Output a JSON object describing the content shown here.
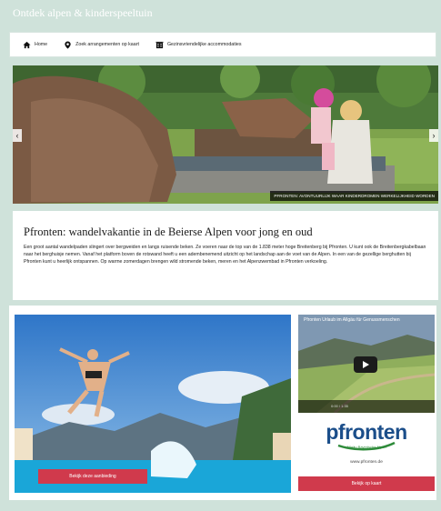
{
  "header": {
    "title": "Ontdek alpen & kinderspeeltuin"
  },
  "nav": {
    "items": [
      {
        "label": "Home",
        "icon": "home-icon"
      },
      {
        "label": "Zoek arrangementen op kaart",
        "icon": "pin-icon"
      },
      {
        "label": "Gezinsvriendelijke accommodaties",
        "icon": "building-icon"
      }
    ]
  },
  "hero": {
    "caption": "PFRONTEN: AVONTUURLIJK WAAR KINDERDROMEN WERKELIJKHEID WORDEN",
    "prev_label": "‹",
    "next_label": "›"
  },
  "article": {
    "title": "Pfronten: wandelvakantie in de Beierse Alpen voor jong en oud",
    "body": "Een groot aantal wandelpaden slingert over bergweiden en langs ruisende beken. Ze voeren naar de top van de 1.838 meter hoge Breitenberg bij Pfronten. U kunt ook de Breitenbergkabelbaan naar het berghuisje nemen. Vanaf het platform boven de rotswand heeft u een adembenemend uitzicht op het landschap aan de voet van de Alpen. In een van de gezellige berghutten bij Pfronten kunt u heerlijk ontspannen. Op warme zomerdagen brengen wild stromende beken, meren en het Alpenzwembad in Pfronten verkoeling."
  },
  "promo": {
    "button_label": "Bekijk deze aanbieding"
  },
  "video": {
    "title": "Pfronten Urlaub im Allgäu für Genussmenschen",
    "time": "0:00 / 1:35"
  },
  "sidebar": {
    "logo_text": "pfronten",
    "logo_tagline": "Allgäu Bayerische Alpen",
    "url": "www.pfronten.de",
    "map_button": "Bekijk op kaart"
  },
  "colors": {
    "accent": "#d03a4c",
    "background": "#cfe2da",
    "logo": "#1b4e8a"
  }
}
